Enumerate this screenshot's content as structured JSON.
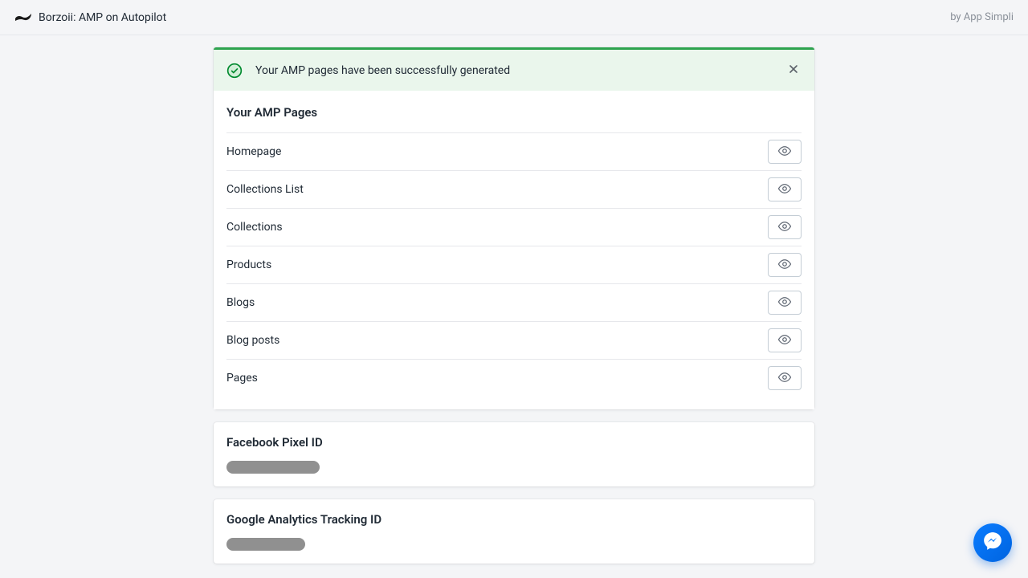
{
  "header": {
    "title": "Borzoii: AMP on Autopilot",
    "byline": "by App Simpli"
  },
  "banner": {
    "message": "Your AMP pages have been successfully generated"
  },
  "pages_card": {
    "title": "Your AMP Pages",
    "items": [
      {
        "label": "Homepage"
      },
      {
        "label": "Collections List"
      },
      {
        "label": "Collections"
      },
      {
        "label": "Products"
      },
      {
        "label": "Blogs"
      },
      {
        "label": "Blog posts"
      },
      {
        "label": "Pages"
      }
    ]
  },
  "fb_card": {
    "title": "Facebook Pixel ID"
  },
  "ga_card": {
    "title": "Google Analytics Tracking ID"
  }
}
